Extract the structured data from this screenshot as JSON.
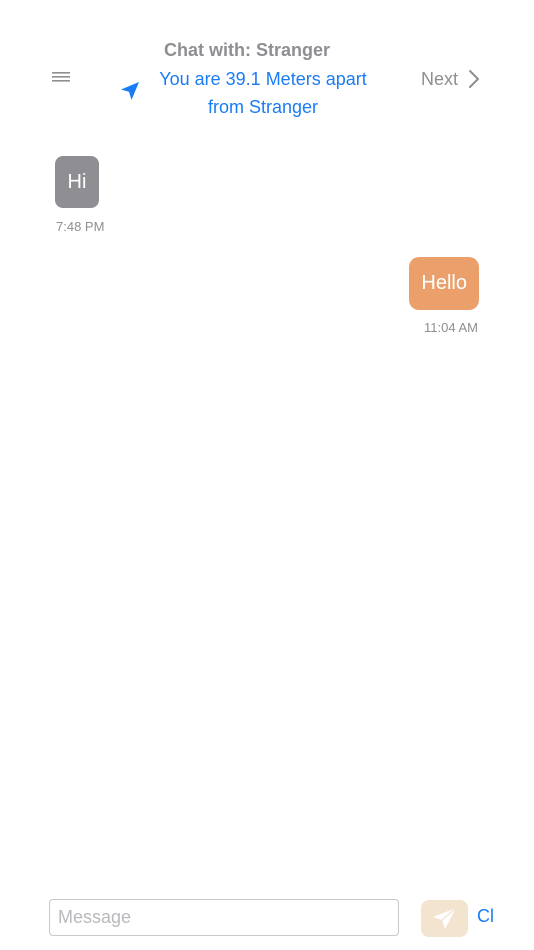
{
  "header": {
    "title": "Chat with: Stranger",
    "distance_text": "You are 39.1 Meters apart from Stranger",
    "next_label": "Next",
    "menu_icon": "hamburger-menu-icon",
    "location_icon": "location-arrow-icon",
    "next_icon": "chevron-right-icon"
  },
  "messages": [
    {
      "direction": "incoming",
      "text": "Hi",
      "time": "7:48 PM"
    },
    {
      "direction": "outgoing",
      "text": "Hello",
      "time": "11:04 AM"
    }
  ],
  "composer": {
    "placeholder": "Message",
    "value": "",
    "send_icon": "paper-plane-icon",
    "clear_label": "Cl"
  },
  "colors": {
    "accent": "#1a7cf5",
    "incoming_bubble": "#8e8e93",
    "outgoing_bubble": "#eba06c",
    "send_button_bg": "#f3e4cf",
    "muted_text": "#8e8e93"
  }
}
